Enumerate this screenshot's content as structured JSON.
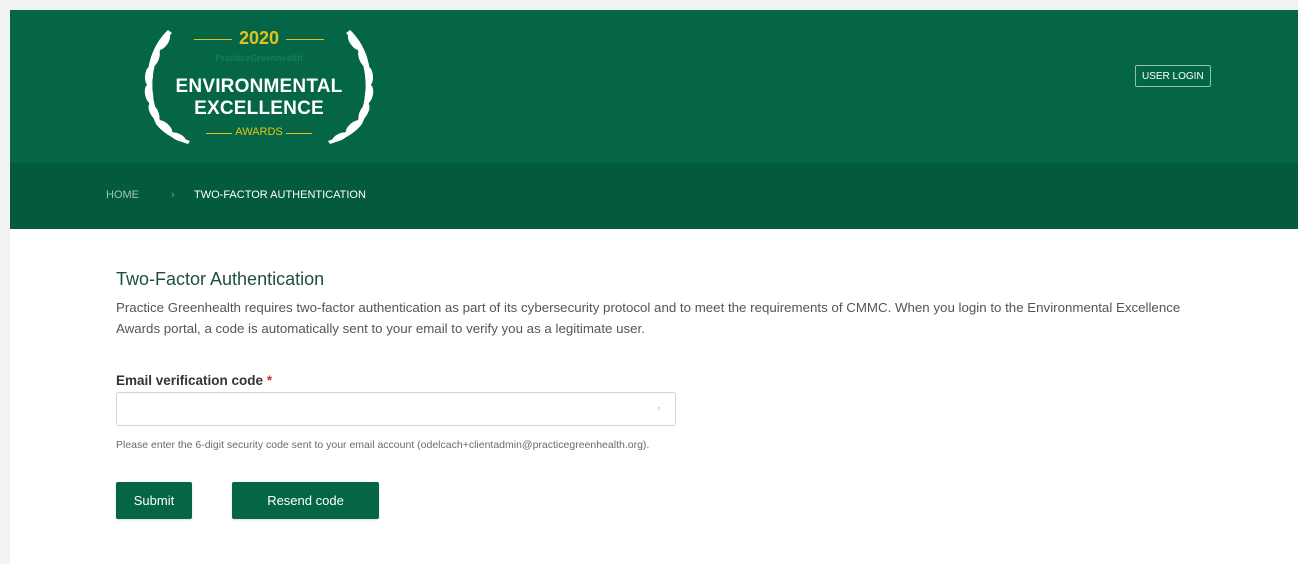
{
  "header": {
    "logo": {
      "year": "2020",
      "sub": "PracticeGreenhealth",
      "title_line1": "ENVIRONMENTAL",
      "title_line2": "EXCELLENCE",
      "awards": "AWARDS"
    },
    "user_login_label": "USER LOGIN"
  },
  "breadcrumb": {
    "home": "HOME",
    "separator": "›",
    "current": "TWO-FACTOR AUTHENTICATION"
  },
  "main": {
    "title": "Two-Factor Authentication",
    "intro": "Practice Greenhealth requires two-factor authentication as part of its cybersecurity protocol and to meet the requirements of CMMC. When you login to the Environmental Excellence Awards portal, a code is automatically sent to your email to verify you as a legitimate user.",
    "field": {
      "label": "Email verification code",
      "required_marker": "*",
      "value": "",
      "placeholder": "",
      "help": "Please enter the 6-digit security code sent to your email account (odelcach+clientadmin@practicegreenhealth.org)."
    },
    "buttons": {
      "submit": "Submit",
      "resend": "Resend code"
    }
  },
  "colors": {
    "brand_green": "#046647",
    "breadcrumb_green": "#035a3f",
    "gold": "#e4c21e"
  }
}
